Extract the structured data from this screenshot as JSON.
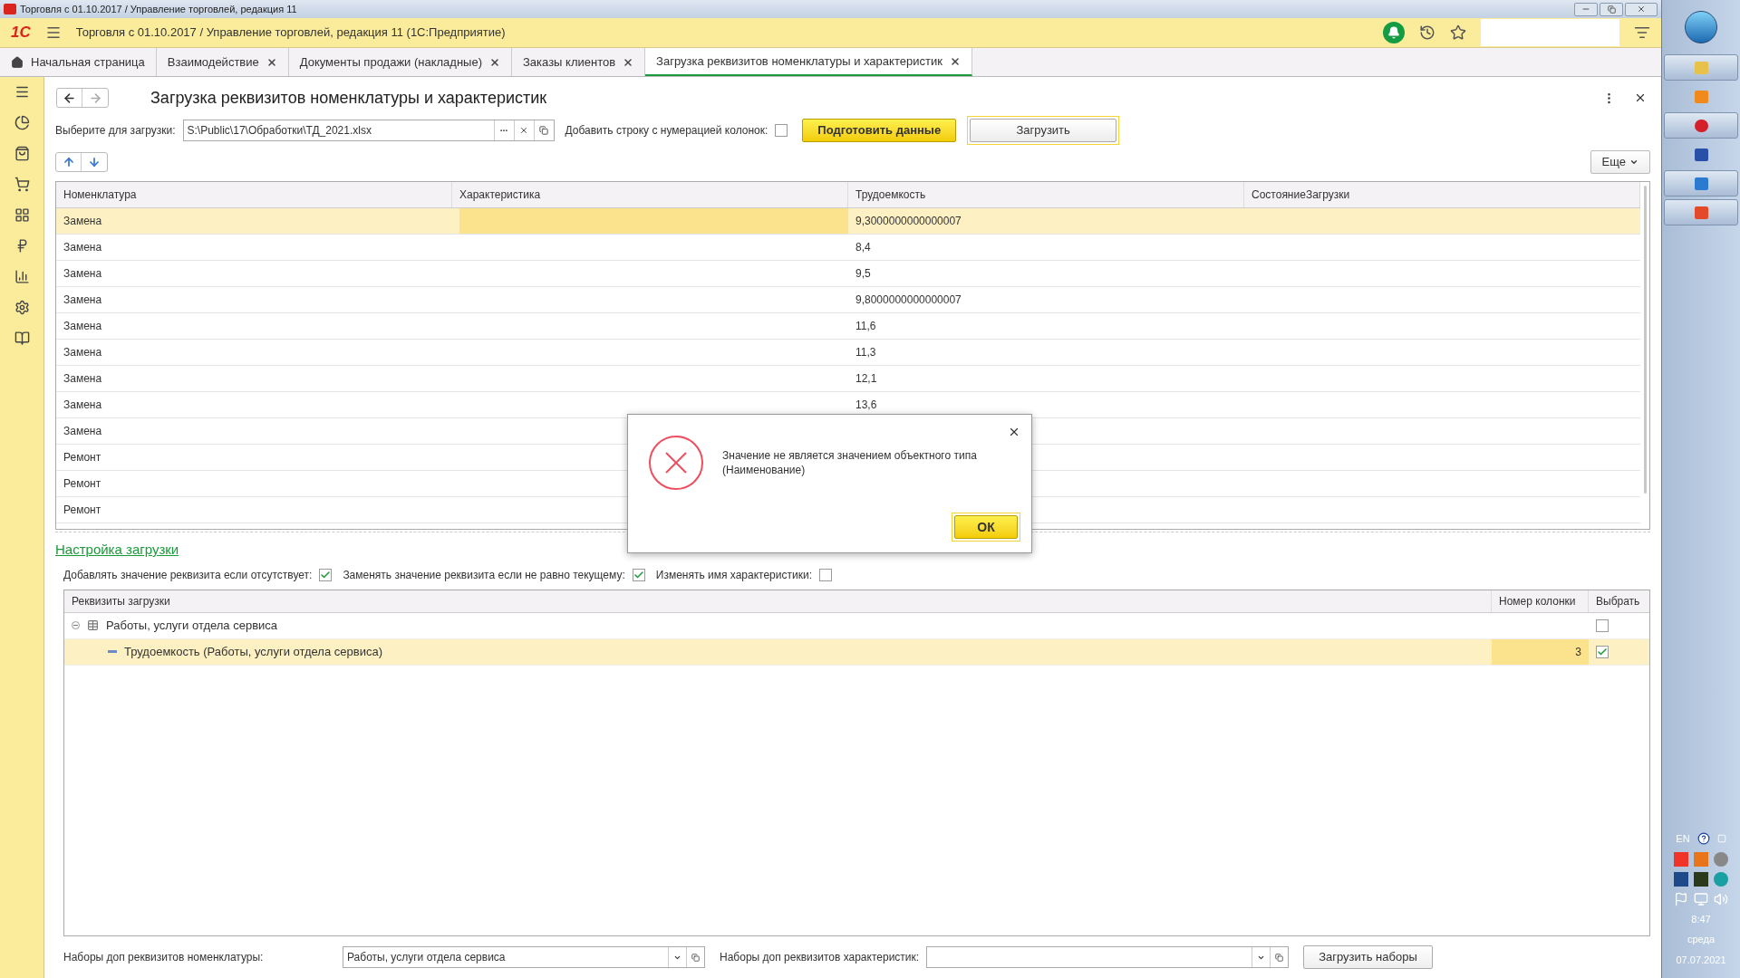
{
  "window": {
    "title": "Торговля с 01.10.2017 / Управление торговлей, редакция 11"
  },
  "app_header": {
    "logo": "1С",
    "title": "Торговля с 01.10.2017 / Управление торговлей, редакция 11  (1С:Предприятие)"
  },
  "tabs": [
    {
      "label": "Начальная страница",
      "kind": "home",
      "selected": false
    },
    {
      "label": "Взаимодействие",
      "kind": "document",
      "selected": false
    },
    {
      "label": "Документы продажи (накладные)",
      "kind": "document",
      "selected": false
    },
    {
      "label": "Заказы клиентов",
      "kind": "document",
      "selected": false
    },
    {
      "label": "Загрузка реквизитов номенклатуры и характеристик",
      "kind": "document",
      "selected": true
    }
  ],
  "form": {
    "title": "Загрузка реквизитов номенклатуры и характеристик",
    "file_label": "Выберите для загрузки:",
    "file_value": "S:\\Public\\17\\Обработки\\ТД_2021.xlsx",
    "numbering_label": "Добавить строку с нумерацией колонок:",
    "numbering_checked": false,
    "prepare_button": "Подготовить данные",
    "load_button": "Загрузить",
    "more_button": "Еще"
  },
  "table": {
    "columns": [
      "Номенклатура",
      "Характеристика",
      "Трудоемкость",
      "СостояниеЗагрузки"
    ],
    "rows": [
      {
        "nomenclature": "Замена",
        "labor": "9,3000000000000007",
        "selected": true
      },
      {
        "nomenclature": "Замена",
        "labor": "8,4",
        "selected": false
      },
      {
        "nomenclature": "Замена",
        "labor": "9,5",
        "selected": false
      },
      {
        "nomenclature": "Замена",
        "labor": "9,8000000000000007",
        "selected": false
      },
      {
        "nomenclature": "Замена",
        "labor": "11,6",
        "selected": false
      },
      {
        "nomenclature": "Замена",
        "labor": "11,3",
        "selected": false
      },
      {
        "nomenclature": "Замена",
        "labor": "12,1",
        "selected": false
      },
      {
        "nomenclature": "Замена",
        "labor": "13,6",
        "selected": false
      },
      {
        "nomenclature": "Замена",
        "selected": false
      },
      {
        "nomenclature": "Ремонт",
        "selected": false
      },
      {
        "nomenclature": "Ремонт",
        "selected": false
      },
      {
        "nomenclature": "Ремонт",
        "selected": false
      }
    ]
  },
  "settings": {
    "link": "Настройка загрузки",
    "options": [
      {
        "label": "Добавлять значение реквизита если отсутствует:",
        "checked": true
      },
      {
        "label": "Заменять значение реквизита если не равно текущему:",
        "checked": true
      },
      {
        "label": "Изменять имя характеристики:",
        "checked": false
      }
    ]
  },
  "tree": {
    "columns": [
      "Реквизиты загрузки",
      "Номер колонки",
      "Выбрать"
    ],
    "items": [
      {
        "label": "Работы, услуги отдела сервиса",
        "expanded": true,
        "checked": false,
        "selected": false,
        "children": [
          {
            "label": "Трудоемкость (Работы, услуги отдела сервиса)",
            "column_number": "3",
            "checked": true,
            "selected": true
          }
        ]
      }
    ]
  },
  "footer": {
    "nom_sets_label": "Наборы доп реквизитов номенклатуры:",
    "nom_sets_value": "Работы, услуги отдела сервиса",
    "char_sets_label": "Наборы доп реквизитов характеристик:",
    "load_sets_button": "Загрузить наборы"
  },
  "dialog": {
    "message": "Значение не является значением объектного типа (Наименование)",
    "ok_button": "ОК"
  },
  "taskbar": {
    "language": "EN",
    "time": "8:47",
    "day": "среда",
    "date": "07.07.2021"
  }
}
